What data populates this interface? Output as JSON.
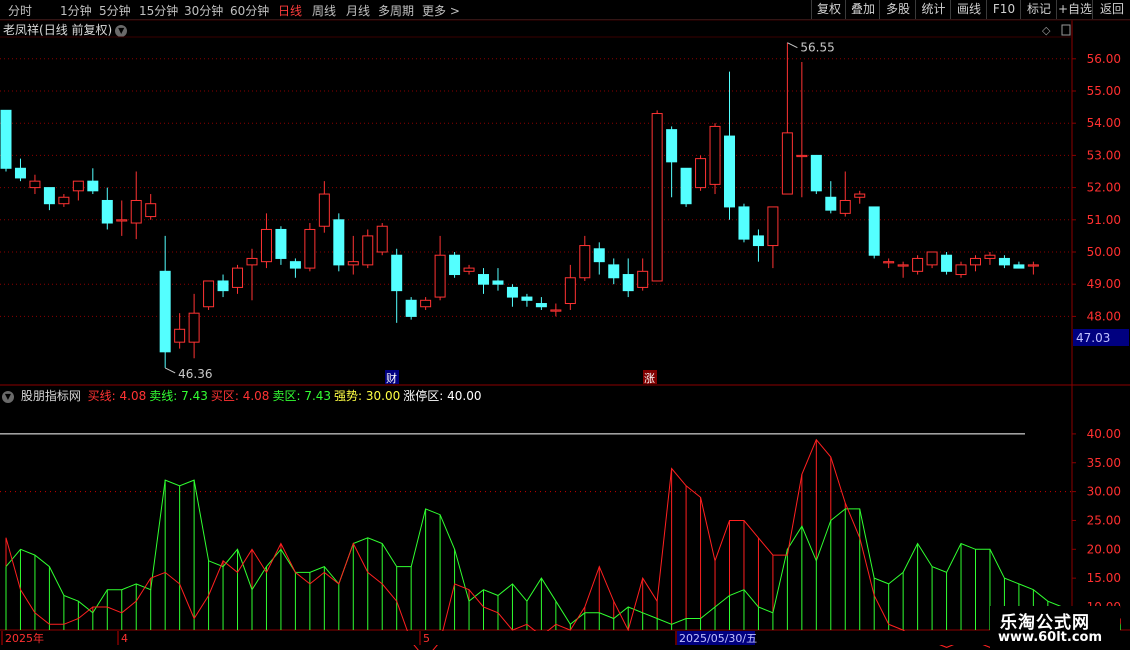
{
  "toolbar": {
    "periods": [
      {
        "label": "分时",
        "active": false
      },
      {
        "label": "1分钟",
        "active": false
      },
      {
        "label": "5分钟",
        "active": false
      },
      {
        "label": "15分钟",
        "active": false
      },
      {
        "label": "30分钟",
        "active": false
      },
      {
        "label": "60分钟",
        "active": false
      },
      {
        "label": "日线",
        "active": true
      },
      {
        "label": "周线",
        "active": false
      },
      {
        "label": "月线",
        "active": false
      },
      {
        "label": "多周期",
        "active": false
      },
      {
        "label": "更多 >",
        "active": false
      }
    ],
    "actions": [
      "复权",
      "叠加",
      "多股",
      "统计",
      "画线",
      "F10",
      "标记",
      "+自选",
      "返回"
    ]
  },
  "stock": {
    "name": "老凤祥",
    "mode": "(日线 前复权)"
  },
  "price_axis": {
    "ticks": [
      "56.00",
      "55.00",
      "54.00",
      "53.00",
      "52.00",
      "51.00",
      "50.00",
      "49.00",
      "48.00"
    ],
    "current": "47.03"
  },
  "annotations": {
    "high": "56.55",
    "low": "46.36",
    "marker_cai": "财",
    "marker_zhang": "涨"
  },
  "indicator": {
    "name": "股朋指标网",
    "items": [
      {
        "label": "买线:",
        "value": "4.08",
        "color": "#ff3333"
      },
      {
        "label": "卖线:",
        "value": "7.43",
        "color": "#33ff33"
      },
      {
        "label": "买区:",
        "value": "4.08",
        "color": "#ff3333"
      },
      {
        "label": "卖区:",
        "value": "7.43",
        "color": "#33ff33"
      },
      {
        "label": "强势:",
        "value": "30.00",
        "color": "#ffff44"
      },
      {
        "label": "涨停区:",
        "value": "40.00",
        "color": "#ffffff"
      }
    ],
    "ticks": [
      "40.00",
      "35.00",
      "30.00",
      "25.00",
      "20.00",
      "15.00",
      "10.00"
    ]
  },
  "date_axis": {
    "labels": [
      "2025年",
      "4",
      "5",
      "2025/05/30/五"
    ]
  },
  "watermark": {
    "line1": "乐淘公式网",
    "line2": "www.60lt.com"
  },
  "colors": {
    "up": "#ff3333",
    "down": "#54ffff",
    "grid": "#8b0000",
    "buy_line": "#ff2020",
    "sell_line": "#30ff30",
    "strong_line": "#ffff40",
    "limit_line": "#ffffff"
  },
  "chart_data": [
    {
      "type": "candlestick",
      "title": "老凤祥 (日线 前复权)",
      "ylim": [
        46.0,
        56.9
      ],
      "candles": [
        {
          "o": 54.4,
          "c": 52.6,
          "h": 54.4,
          "l": 52.5
        },
        {
          "o": 52.6,
          "c": 52.3,
          "h": 52.9,
          "l": 52.2
        },
        {
          "o": 52.0,
          "c": 52.2,
          "h": 52.4,
          "l": 51.8
        },
        {
          "o": 52.0,
          "c": 51.5,
          "h": 52.0,
          "l": 51.3
        },
        {
          "o": 51.5,
          "c": 51.7,
          "h": 51.8,
          "l": 51.4
        },
        {
          "o": 51.9,
          "c": 52.2,
          "h": 52.2,
          "l": 51.6
        },
        {
          "o": 52.2,
          "c": 51.9,
          "h": 52.6,
          "l": 51.8
        },
        {
          "o": 51.6,
          "c": 50.9,
          "h": 52.0,
          "l": 50.7
        },
        {
          "o": 51.0,
          "c": 51.0,
          "h": 51.6,
          "l": 50.5
        },
        {
          "o": 50.9,
          "c": 51.6,
          "h": 52.5,
          "l": 50.4
        },
        {
          "o": 51.1,
          "c": 51.5,
          "h": 51.8,
          "l": 51.0
        },
        {
          "o": 49.4,
          "c": 46.9,
          "h": 50.5,
          "l": 46.4
        },
        {
          "o": 47.2,
          "c": 47.6,
          "h": 48.1,
          "l": 47.0
        },
        {
          "o": 47.2,
          "c": 48.1,
          "h": 48.7,
          "l": 46.7
        },
        {
          "o": 48.3,
          "c": 49.1,
          "h": 49.1,
          "l": 48.2
        },
        {
          "o": 49.1,
          "c": 48.8,
          "h": 49.3,
          "l": 48.6
        },
        {
          "o": 48.9,
          "c": 49.5,
          "h": 49.6,
          "l": 48.7
        },
        {
          "o": 49.6,
          "c": 49.8,
          "h": 50.1,
          "l": 48.5
        },
        {
          "o": 49.7,
          "c": 50.7,
          "h": 51.2,
          "l": 49.5
        },
        {
          "o": 50.7,
          "c": 49.8,
          "h": 50.8,
          "l": 49.6
        },
        {
          "o": 49.7,
          "c": 49.5,
          "h": 49.8,
          "l": 49.2
        },
        {
          "o": 49.5,
          "c": 50.7,
          "h": 50.9,
          "l": 49.4
        },
        {
          "o": 50.8,
          "c": 51.8,
          "h": 52.2,
          "l": 50.6
        },
        {
          "o": 51.0,
          "c": 49.6,
          "h": 51.2,
          "l": 49.4
        },
        {
          "o": 49.6,
          "c": 49.7,
          "h": 50.5,
          "l": 49.3
        },
        {
          "o": 49.6,
          "c": 50.5,
          "h": 50.7,
          "l": 49.5
        },
        {
          "o": 50.0,
          "c": 50.8,
          "h": 50.9,
          "l": 49.9
        },
        {
          "o": 49.9,
          "c": 48.8,
          "h": 50.1,
          "l": 47.8
        },
        {
          "o": 48.5,
          "c": 48.0,
          "h": 48.6,
          "l": 47.9
        },
        {
          "o": 48.3,
          "c": 48.5,
          "h": 48.6,
          "l": 48.2
        },
        {
          "o": 48.6,
          "c": 49.9,
          "h": 50.5,
          "l": 48.5
        },
        {
          "o": 49.9,
          "c": 49.3,
          "h": 50.0,
          "l": 49.2
        },
        {
          "o": 49.4,
          "c": 49.5,
          "h": 49.6,
          "l": 49.3
        },
        {
          "o": 49.3,
          "c": 49.0,
          "h": 49.5,
          "l": 48.7
        },
        {
          "o": 49.1,
          "c": 49.0,
          "h": 49.5,
          "l": 48.8
        },
        {
          "o": 48.9,
          "c": 48.6,
          "h": 49.0,
          "l": 48.3
        },
        {
          "o": 48.6,
          "c": 48.5,
          "h": 48.7,
          "l": 48.3
        },
        {
          "o": 48.4,
          "c": 48.3,
          "h": 48.6,
          "l": 48.2
        },
        {
          "o": 48.2,
          "c": 48.2,
          "h": 48.4,
          "l": 48.0
        },
        {
          "o": 48.4,
          "c": 49.2,
          "h": 49.6,
          "l": 48.2
        },
        {
          "o": 49.2,
          "c": 50.2,
          "h": 50.5,
          "l": 49.1
        },
        {
          "o": 50.1,
          "c": 49.7,
          "h": 50.3,
          "l": 49.3
        },
        {
          "o": 49.6,
          "c": 49.2,
          "h": 49.8,
          "l": 49.0
        },
        {
          "o": 49.3,
          "c": 48.8,
          "h": 49.8,
          "l": 48.6
        },
        {
          "o": 48.9,
          "c": 49.4,
          "h": 49.8,
          "l": 48.8
        },
        {
          "o": 49.1,
          "c": 54.3,
          "h": 54.4,
          "l": 49.1
        },
        {
          "o": 53.8,
          "c": 52.8,
          "h": 53.9,
          "l": 51.7
        },
        {
          "o": 52.6,
          "c": 51.5,
          "h": 52.6,
          "l": 51.4
        },
        {
          "o": 52.0,
          "c": 52.9,
          "h": 53.0,
          "l": 51.9
        },
        {
          "o": 52.1,
          "c": 53.9,
          "h": 54.0,
          "l": 51.8
        },
        {
          "o": 53.6,
          "c": 51.4,
          "h": 55.6,
          "l": 51.0
        },
        {
          "o": 51.4,
          "c": 50.4,
          "h": 51.5,
          "l": 50.3
        },
        {
          "o": 50.5,
          "c": 50.2,
          "h": 50.7,
          "l": 49.7
        },
        {
          "o": 50.2,
          "c": 51.4,
          "h": 51.4,
          "l": 49.5
        },
        {
          "o": 51.8,
          "c": 53.7,
          "h": 56.5,
          "l": 51.8
        },
        {
          "o": 53.0,
          "c": 53.0,
          "h": 55.9,
          "l": 51.7
        },
        {
          "o": 53.0,
          "c": 51.9,
          "h": 53.0,
          "l": 51.8
        },
        {
          "o": 51.7,
          "c": 51.3,
          "h": 52.2,
          "l": 51.2
        },
        {
          "o": 51.2,
          "c": 51.6,
          "h": 52.5,
          "l": 51.1
        },
        {
          "o": 51.7,
          "c": 51.8,
          "h": 51.9,
          "l": 51.5
        },
        {
          "o": 51.4,
          "c": 49.9,
          "h": 51.4,
          "l": 49.8
        },
        {
          "o": 49.7,
          "c": 49.7,
          "h": 49.8,
          "l": 49.5
        },
        {
          "o": 49.6,
          "c": 49.6,
          "h": 49.7,
          "l": 49.2
        },
        {
          "o": 49.4,
          "c": 49.8,
          "h": 49.9,
          "l": 49.3
        },
        {
          "o": 49.6,
          "c": 50.0,
          "h": 50.0,
          "l": 49.5
        },
        {
          "o": 49.9,
          "c": 49.4,
          "h": 50.0,
          "l": 49.3
        },
        {
          "o": 49.3,
          "c": 49.6,
          "h": 49.7,
          "l": 49.2
        },
        {
          "o": 49.6,
          "c": 49.8,
          "h": 49.9,
          "l": 49.4
        },
        {
          "o": 49.8,
          "c": 49.9,
          "h": 50.0,
          "l": 49.6
        },
        {
          "o": 49.8,
          "c": 49.6,
          "h": 49.9,
          "l": 49.5
        },
        {
          "o": 49.6,
          "c": 49.5,
          "h": 49.7,
          "l": 49.5
        },
        {
          "o": 49.6,
          "c": 49.6,
          "h": 49.7,
          "l": 49.3
        }
      ]
    },
    {
      "type": "line",
      "title": "股朋指标网",
      "ylim": [
        5,
        42
      ],
      "series": [
        {
          "name": "卖线",
          "values": [
            17,
            20,
            19,
            17,
            12,
            11,
            9,
            13,
            13,
            14,
            13,
            32,
            31,
            32,
            18,
            17,
            20,
            13,
            17,
            20,
            16,
            16,
            17,
            14,
            21,
            22,
            21,
            17,
            17,
            27,
            26,
            20,
            11,
            13,
            12,
            14,
            11,
            15,
            11,
            7,
            9,
            9,
            8,
            10,
            9,
            8,
            7,
            8,
            8,
            10,
            12,
            13,
            10,
            9,
            20,
            24,
            18,
            25,
            27,
            27,
            15,
            14,
            16,
            21,
            17,
            16,
            21,
            20,
            20,
            15,
            14,
            13,
            11,
            10,
            9,
            8,
            9,
            7
          ]
        },
        {
          "name": "买线",
          "values": [
            22,
            13,
            9,
            7,
            7,
            8,
            10,
            10,
            9,
            11,
            15,
            16,
            14,
            8,
            12,
            18,
            16,
            20,
            16,
            21,
            16,
            14,
            16,
            14,
            21,
            16,
            14,
            11,
            4,
            1,
            4,
            14,
            13,
            10,
            9,
            6,
            7,
            5,
            7,
            6,
            10,
            17,
            11,
            6,
            15,
            11,
            34,
            31,
            29,
            18,
            25,
            25,
            22,
            19,
            19,
            33,
            39,
            36,
            28,
            22,
            12,
            7,
            6,
            4,
            4,
            3,
            4,
            4,
            3,
            5,
            7,
            9,
            8,
            10,
            9,
            8,
            7,
            8
          ]
        }
      ]
    }
  ]
}
